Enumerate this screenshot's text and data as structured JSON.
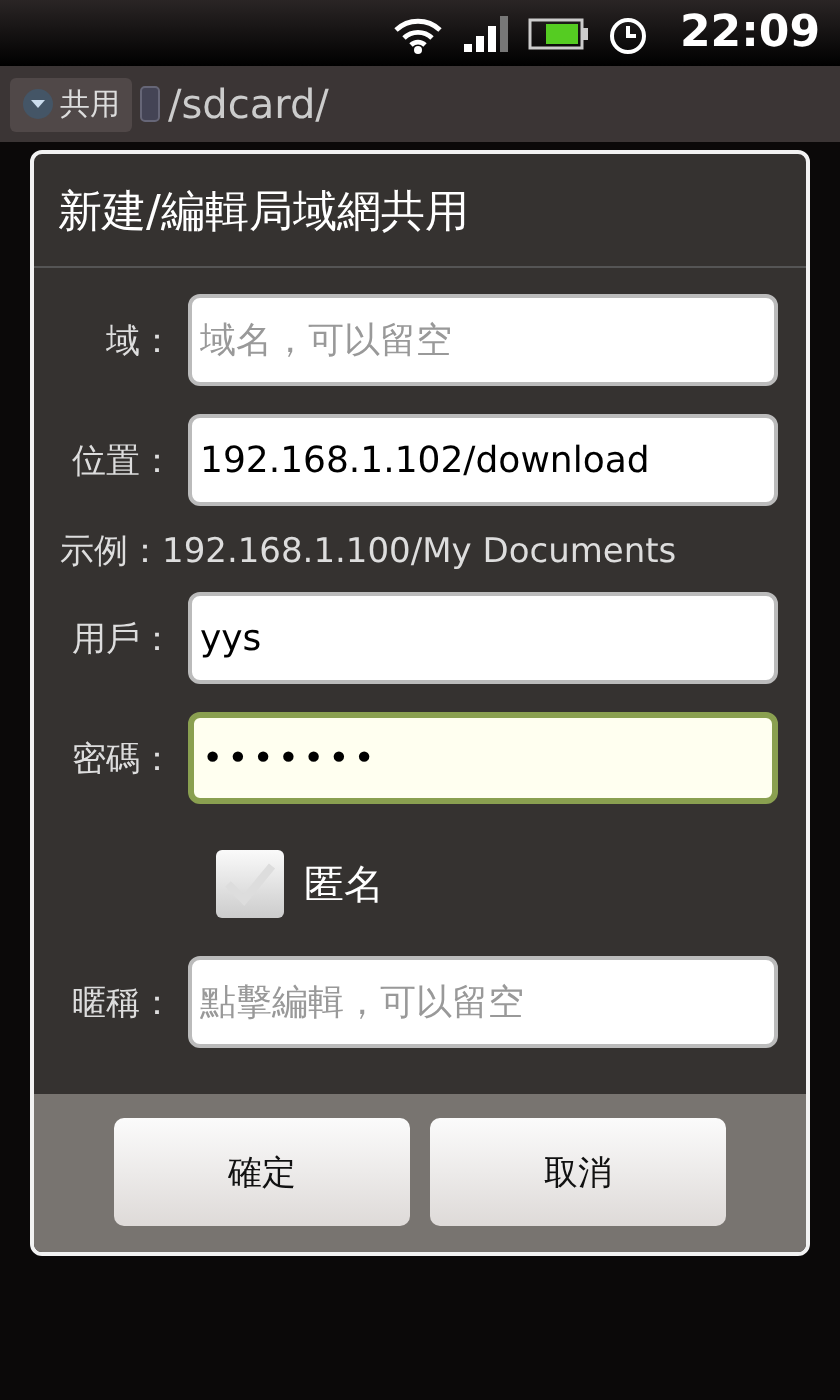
{
  "status_bar": {
    "time": "22:09"
  },
  "toolbar": {
    "share_button": "共用",
    "path": "/sdcard/"
  },
  "dialog": {
    "title": "新建/編輯局域網共用",
    "rows": [
      {
        "kind": "field",
        "label": "域：",
        "placeholder": "域名，可以留空",
        "focused": false
      },
      {
        "kind": "field",
        "label": "位置：",
        "value": "192.168.1.102/download",
        "focused": false
      },
      {
        "kind": "hint",
        "text": "示例：192.168.1.100/My Documents"
      },
      {
        "kind": "field",
        "label": "用戶：",
        "value": "yys",
        "focused": false
      },
      {
        "kind": "password",
        "label": "密碼：",
        "value": "•••••••",
        "focused": true
      },
      {
        "kind": "checkbox",
        "label": "匿名",
        "checked": false
      },
      {
        "kind": "field",
        "label": "暱稱：",
        "placeholder": "點擊編輯，可以留空",
        "focused": false
      }
    ],
    "buttons": [
      "確定",
      "取消"
    ]
  }
}
